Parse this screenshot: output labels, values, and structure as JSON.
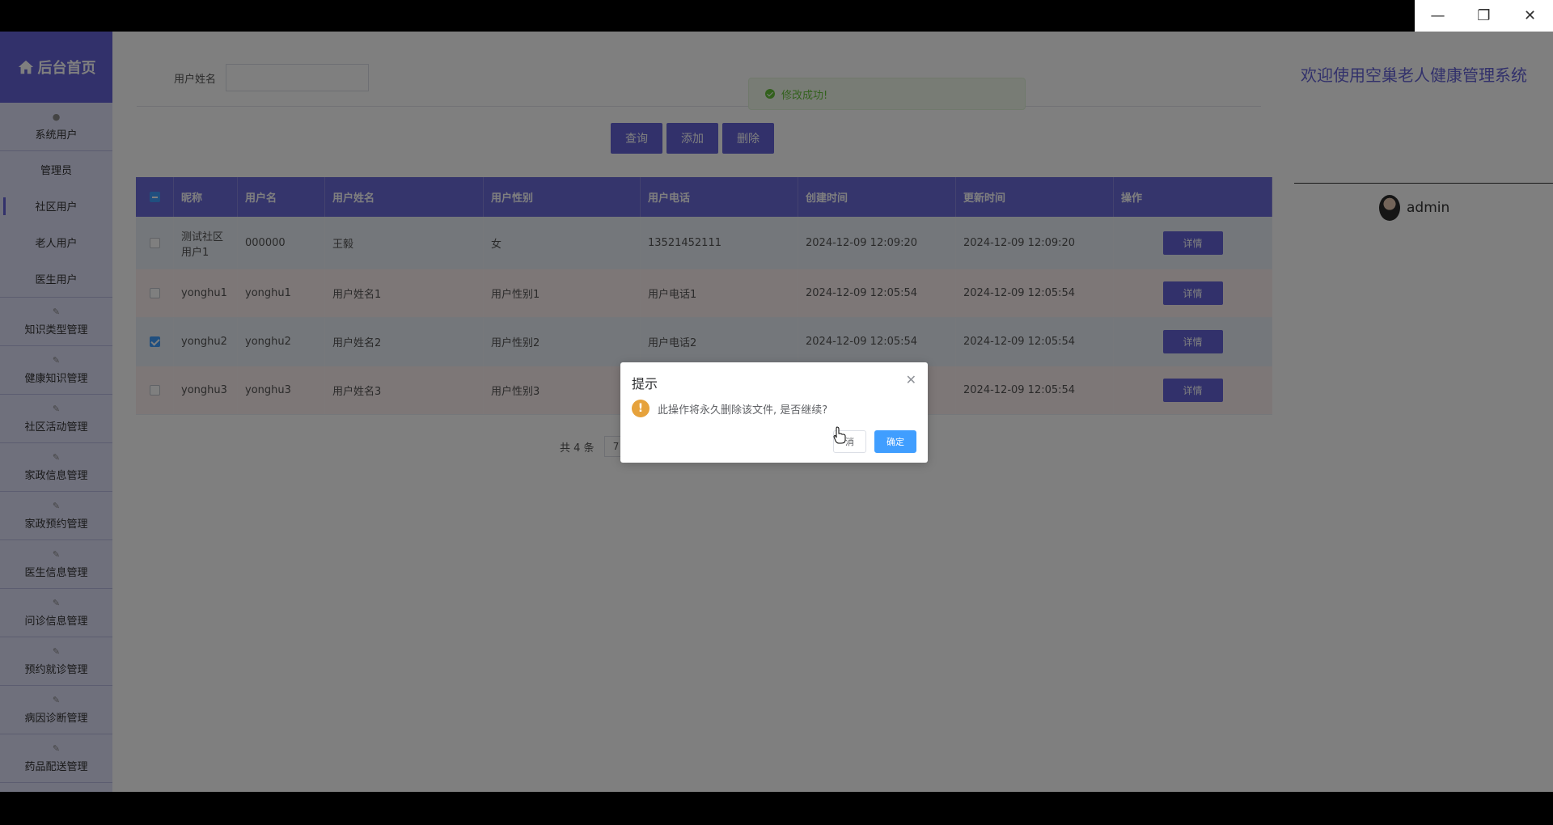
{
  "window": {
    "minimize_icon": "minimize-icon",
    "restore_icon": "restore-icon",
    "close_icon": "close-icon"
  },
  "sidebar": {
    "brand": "后台首页",
    "group_system": "系统用户",
    "sub_items": [
      {
        "label": "管理员"
      },
      {
        "label": "社区用户"
      },
      {
        "label": "老人用户"
      },
      {
        "label": "医生用户"
      }
    ],
    "groups": [
      {
        "label": "知识类型管理"
      },
      {
        "label": "健康知识管理"
      },
      {
        "label": "社区活动管理"
      },
      {
        "label": "家政信息管理"
      },
      {
        "label": "家政预约管理"
      },
      {
        "label": "医生信息管理"
      },
      {
        "label": "问诊信息管理"
      },
      {
        "label": "预约就诊管理"
      },
      {
        "label": "病因诊断管理"
      },
      {
        "label": "药品配送管理"
      }
    ]
  },
  "header": {
    "welcome": "欢迎使用空巢老人健康管理系统",
    "username": "admin"
  },
  "search": {
    "label": "用户姓名",
    "value": ""
  },
  "toolbar": {
    "query": "查询",
    "add": "添加",
    "delete": "删除"
  },
  "toast": {
    "message": "修改成功!"
  },
  "table": {
    "columns": [
      "昵称",
      "用户名",
      "用户姓名",
      "用户性别",
      "用户电话",
      "创建时间",
      "更新时间",
      "操作"
    ],
    "rows": [
      {
        "nickname": "测试社区用户1",
        "username": "000000",
        "name": "王毅",
        "gender": "女",
        "phone": "13521452111",
        "created": "2024-12-09 12:09:20",
        "updated": "2024-12-09 12:09:20",
        "action": "详情"
      },
      {
        "nickname": "yonghu1",
        "username": "yonghu1",
        "name": "用户姓名1",
        "gender": "用户性别1",
        "phone": "用户电话1",
        "created": "2024-12-09 12:05:54",
        "updated": "2024-12-09 12:05:54",
        "action": "详情"
      },
      {
        "nickname": "yonghu2",
        "username": "yonghu2",
        "name": "用户姓名2",
        "gender": "用户性别2",
        "phone": "用户电话2",
        "created": "2024-12-09 12:05:54",
        "updated": "2024-12-09 12:05:54",
        "action": "详情"
      },
      {
        "nickname": "yonghu3",
        "username": "yonghu3",
        "name": "用户姓名3",
        "gender": "用户性别3",
        "phone": "",
        "created": "",
        "updated": "2024-12-09 12:05:54",
        "action": "详情"
      }
    ]
  },
  "pager": {
    "total": "共 4 条",
    "page_size": "7"
  },
  "dialog": {
    "title": "提示",
    "message": "此操作将永久删除该文件, 是否继续?",
    "cancel": "消",
    "ok": "确定"
  }
}
